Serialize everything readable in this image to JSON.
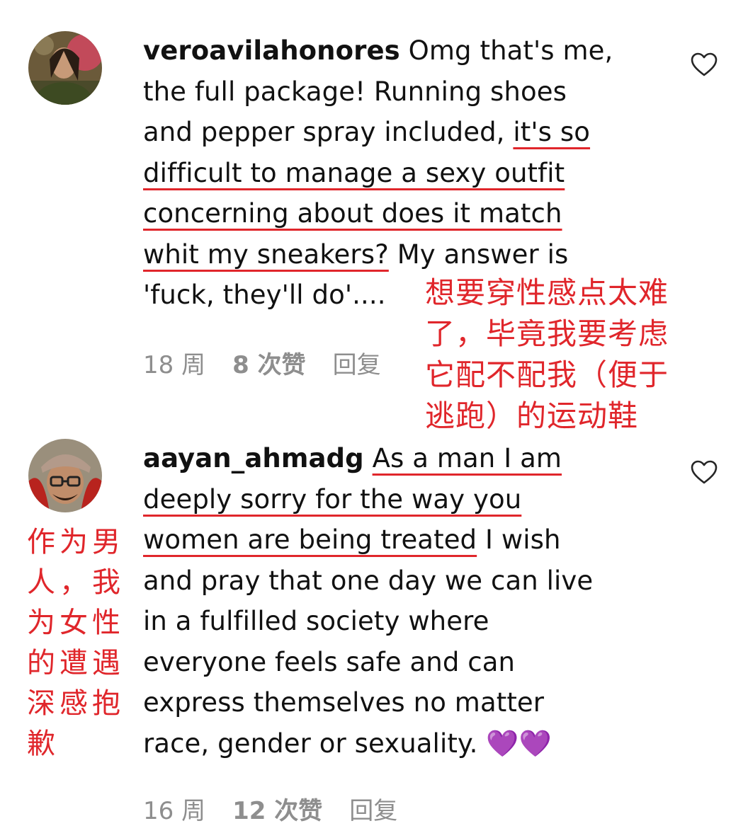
{
  "comments": [
    {
      "username": "veroavilahonores",
      "lines": [
        [
          {
            "t": " Omg that's me,"
          }
        ],
        [
          {
            "t": "the full package! Running shoes"
          }
        ],
        [
          {
            "t": "and pepper spray included, "
          },
          {
            "t": "it's so",
            "u": true
          }
        ],
        [
          {
            "t": "difficult to manage a sexy outfit",
            "u": true
          }
        ],
        [
          {
            "t": "concerning about does it match",
            "u": true
          }
        ],
        [
          {
            "t": "whit my sneakers?",
            "u": true
          },
          {
            "t": " My answer is"
          }
        ],
        [
          {
            "t": "'fuck, they'll do'...."
          }
        ]
      ],
      "time": "18 周",
      "likes": "8 次赞",
      "reply": "回复",
      "annotation_lines": [
        "想要穿性感点太难",
        "了，毕竟我要考虑",
        "它配不配我（便于",
        "逃跑）的运动鞋"
      ]
    },
    {
      "username": "aayan_ahmadg",
      "lines": [
        [
          {
            "t": " "
          },
          {
            "t": "As a man I am",
            "u": true
          }
        ],
        [
          {
            "t": "deeply sorry for the way you",
            "u": true
          }
        ],
        [
          {
            "t": "women are being treated",
            "u": true
          },
          {
            "t": " I wish"
          }
        ],
        [
          {
            "t": "and pray that one day we can live"
          }
        ],
        [
          {
            "t": "in a fulfilled society where"
          }
        ],
        [
          {
            "t": "everyone feels safe and can"
          }
        ],
        [
          {
            "t": "express themselves no matter"
          }
        ],
        [
          {
            "t": "race, gender or sexuality. 💜💜"
          }
        ]
      ],
      "time": "16 周",
      "likes": "12 次赞",
      "reply": "回复",
      "annotation_lines": [
        "作为男",
        "人，我",
        "为女性",
        "的遭遇",
        "深感抱",
        "歉"
      ]
    }
  ],
  "icons": {
    "like": "heart-icon"
  },
  "colors": {
    "annotation": "#e0262b",
    "meta_text": "#8e8e8e",
    "text": "#111111"
  }
}
